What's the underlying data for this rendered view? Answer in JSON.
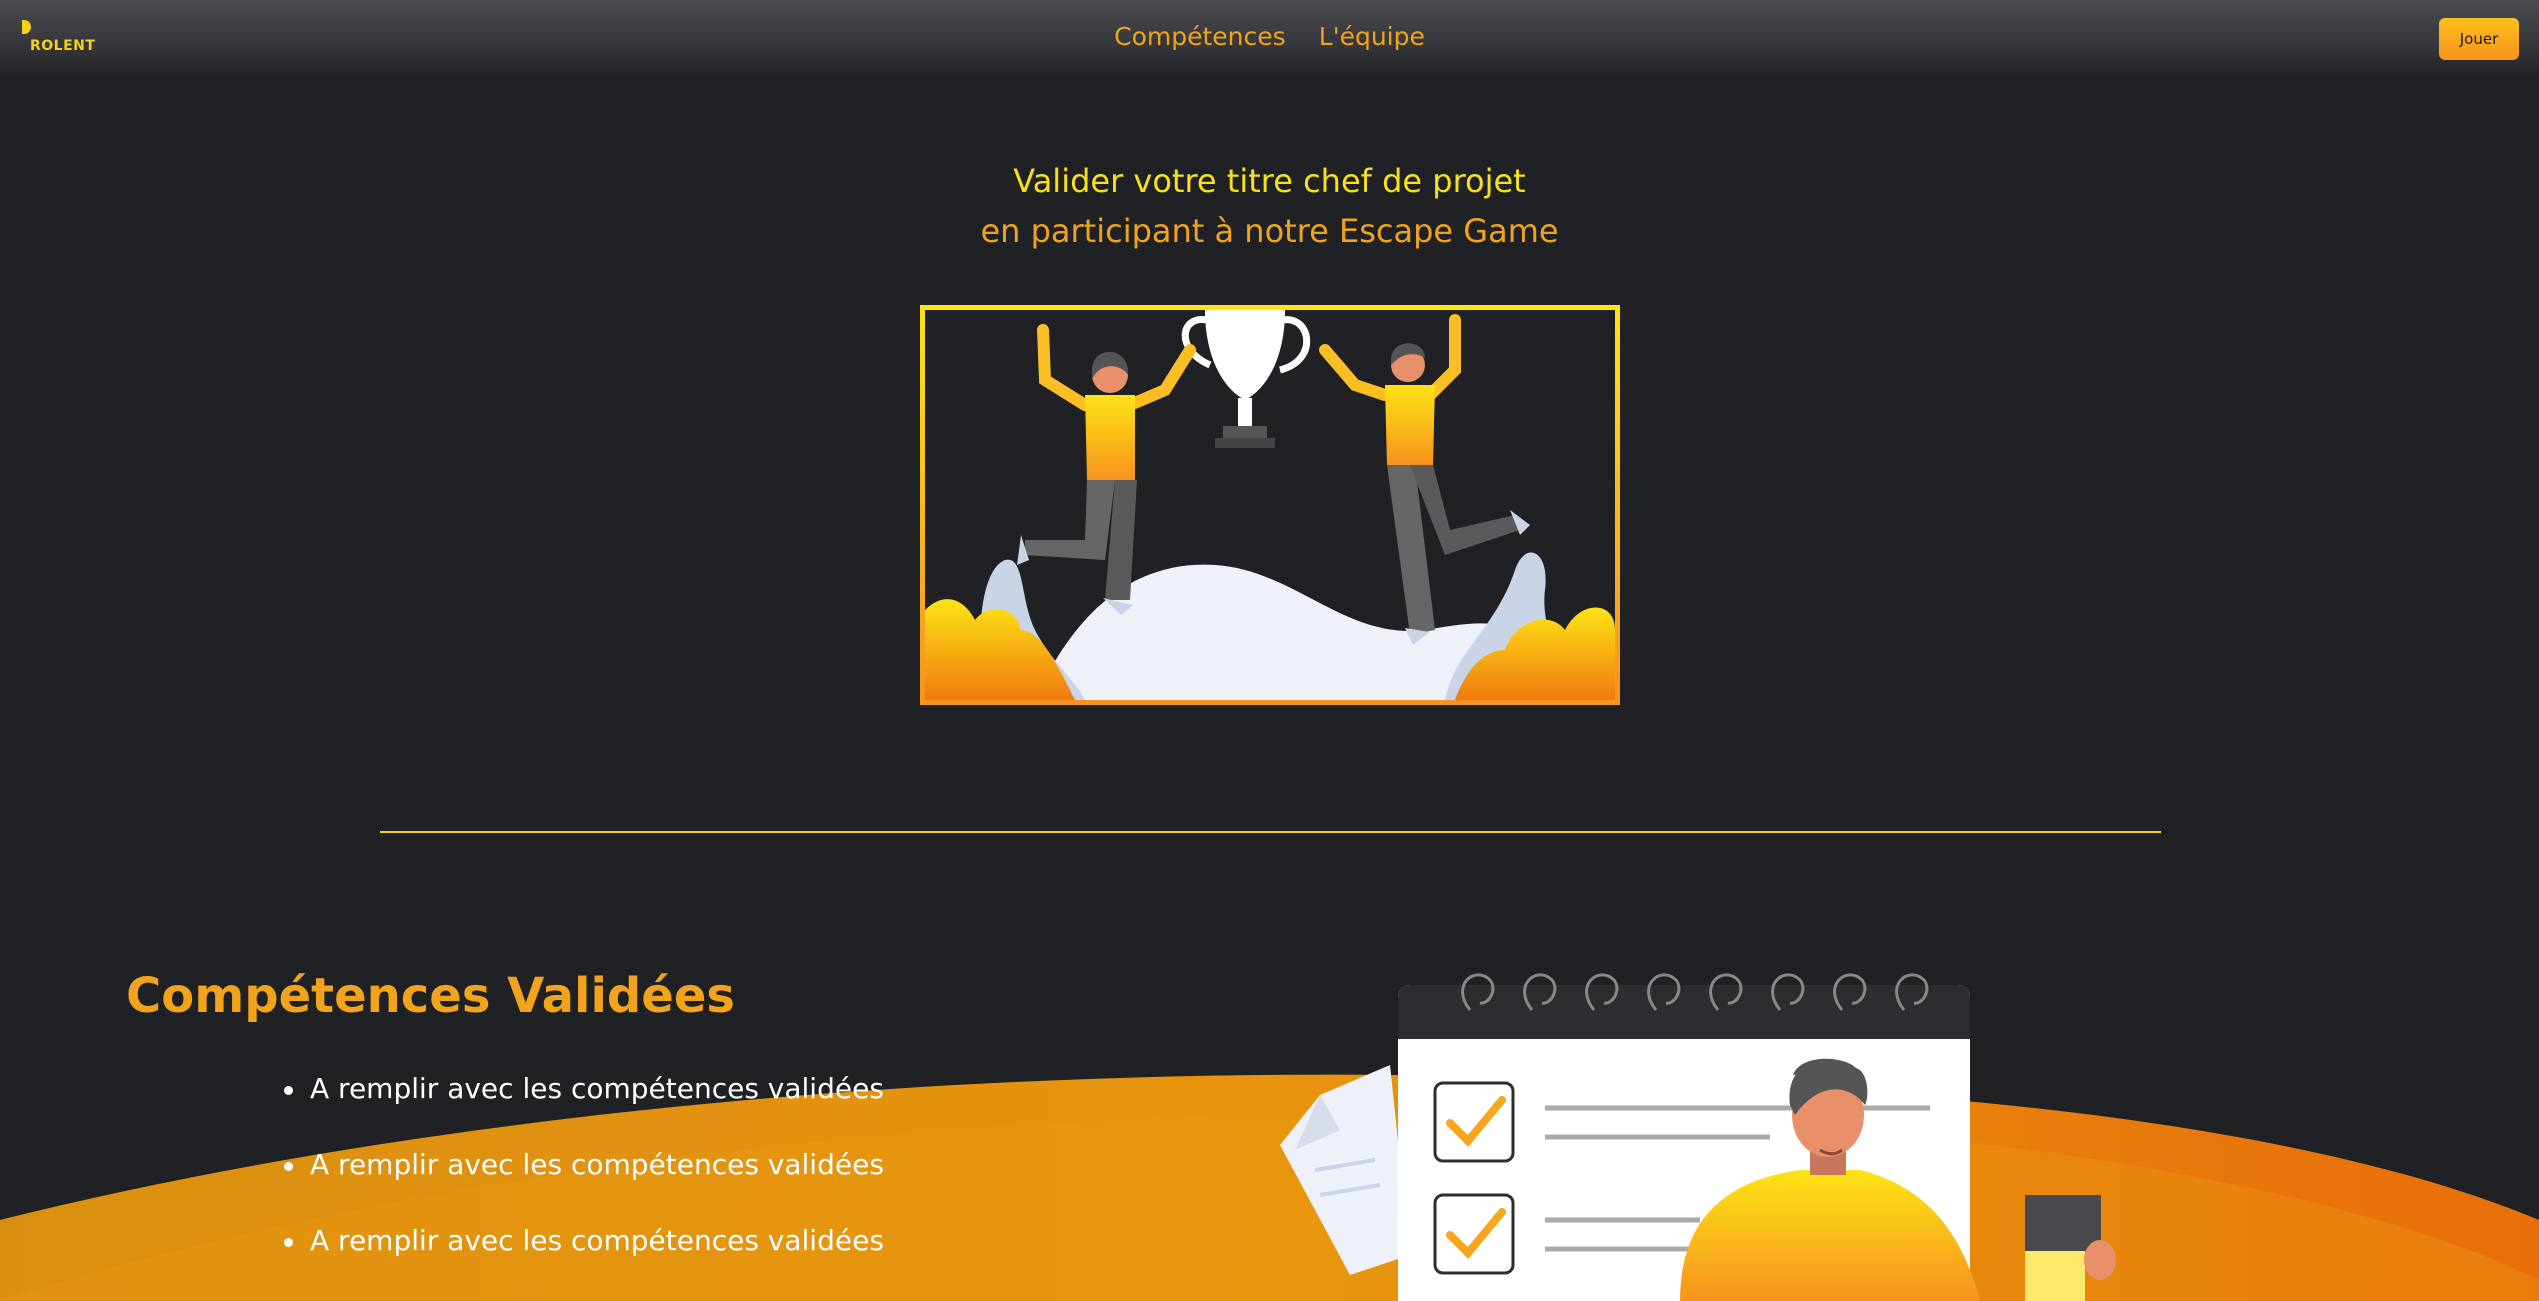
{
  "navbar": {
    "logo_text": "ROLENT",
    "links": [
      {
        "label": "Compétences"
      },
      {
        "label": "L'équipe"
      }
    ],
    "play_button_label": "Jouer"
  },
  "hero": {
    "title": "Valider votre titre chef de projet",
    "subtitle": "en participant à notre Escape Game",
    "illustration": "two-people-celebrating-trophy"
  },
  "skills_section": {
    "title": "Compétences Validées",
    "items": [
      {
        "label": "A remplir avec les compétences validées"
      },
      {
        "label": "A remplir avec les compétences validées"
      },
      {
        "label": "A remplir avec les compétences validées"
      }
    ],
    "illustration": "person-with-checklist-calendar"
  },
  "colors": {
    "background": "#202124",
    "accent_yellow": "#f7e11a",
    "accent_orange": "#f0a31b",
    "wave_orange": "#e8890f"
  }
}
